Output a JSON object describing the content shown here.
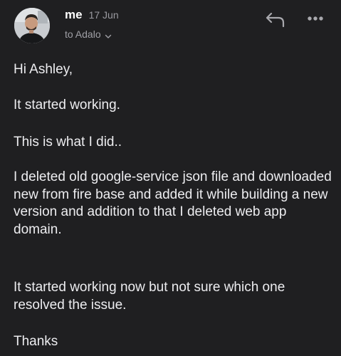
{
  "header": {
    "sender": "me",
    "date": "17 Jun",
    "recipient": "to Adalo",
    "icons": {
      "reply": "reply-icon",
      "more": "more-horizontal-icon",
      "expand": "chevron-down-icon"
    }
  },
  "message": {
    "greeting": "Hi Ashley,",
    "line1": "It started working.",
    "line2": "This is what I did..",
    "line3": "I deleted old google-service json file and downloaded new from fire base and added it while building a new version and addition to that I deleted web app domain.",
    "line4": "It started working now but not sure which one resolved the issue.",
    "signoff": "Thanks"
  },
  "colors": {
    "background": "#1f1f21",
    "text": "#ededf0",
    "muted": "#9a9aa0"
  }
}
